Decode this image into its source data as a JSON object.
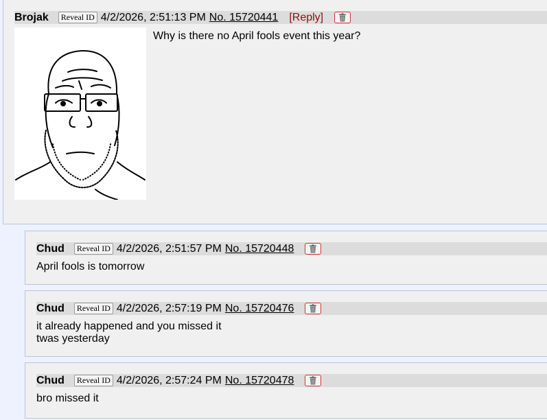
{
  "op": {
    "name": "Brojak",
    "reveal_label": "Reveal ID",
    "date": "4/2/2026, 2:51:13 PM",
    "post_no": "No. 15720441",
    "reply_link": "[Reply]",
    "text": "Why is there no April fools event this year?",
    "image_icon": "wojak-glasses-beard-drawing"
  },
  "replies": [
    {
      "name": "Chud",
      "reveal_label": "Reveal ID",
      "date": "4/2/2026, 2:51:57 PM",
      "post_no": "No. 15720448",
      "lines": [
        "April fools is tomorrow"
      ]
    },
    {
      "name": "Chud",
      "reveal_label": "Reveal ID",
      "date": "4/2/2026, 2:57:19 PM",
      "post_no": "No. 15720476",
      "lines": [
        "it already happened and you missed it",
        "twas yesterday"
      ]
    },
    {
      "name": "Chud",
      "reveal_label": "Reveal ID",
      "date": "4/2/2026, 2:57:24 PM",
      "post_no": "No. 15720478",
      "lines": [
        "bro missed it"
      ]
    }
  ],
  "icons": {
    "delete": "trash-icon"
  },
  "colors": {
    "reply_link": "#8b1010",
    "delete_border": "#d23232",
    "page_bg": "#eef2ff",
    "post_bg": "#f0f0f0"
  }
}
